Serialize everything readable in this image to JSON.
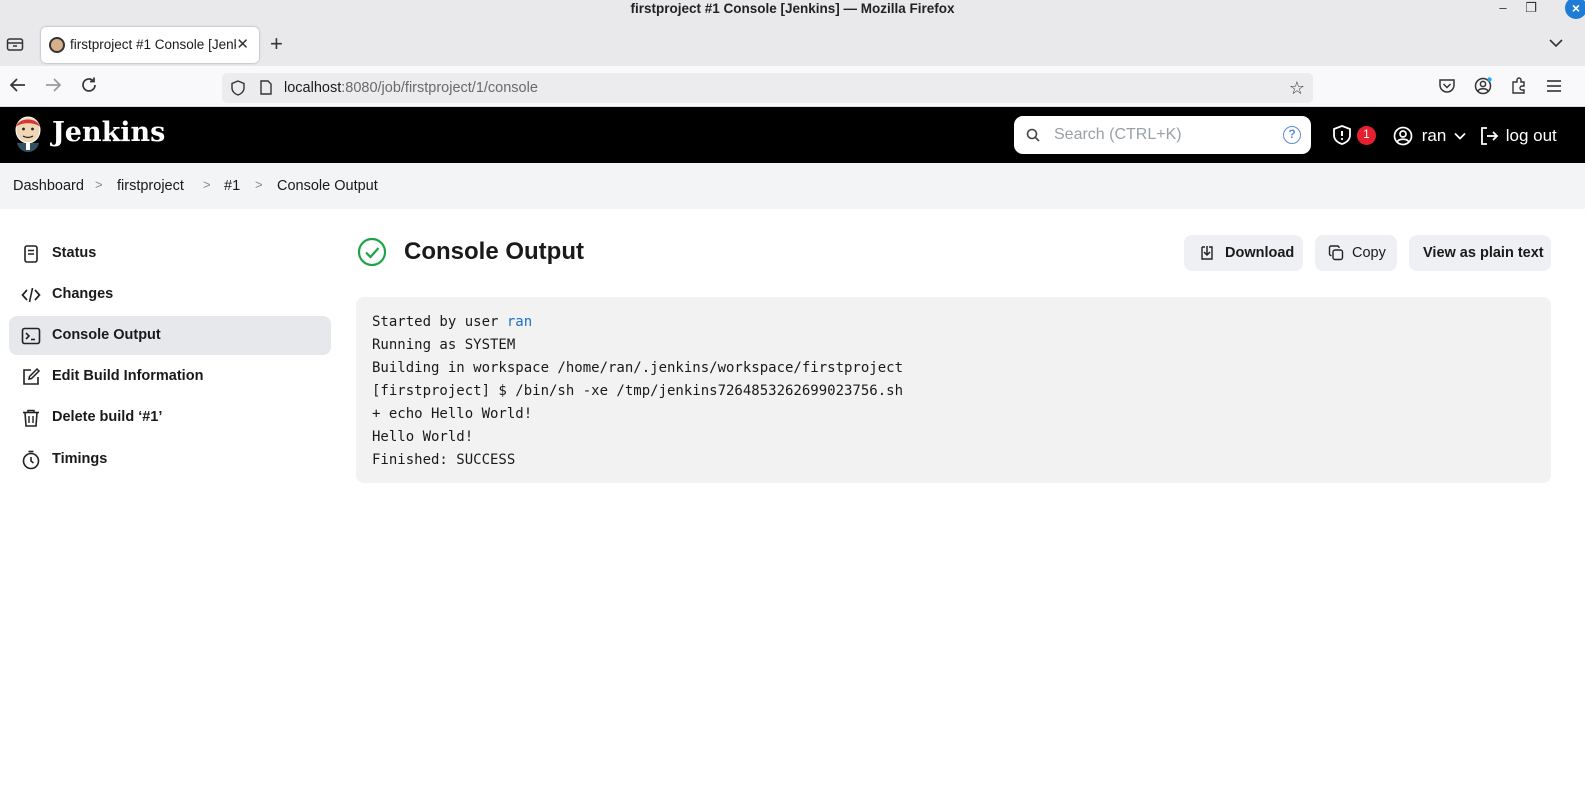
{
  "browser": {
    "window_title": "firstproject #1 Console [Jenkins] — Mozilla Firefox",
    "tab_title": "firstproject #1 Console [Jenkins]",
    "url_host": "localhost",
    "url_rest": ":8080/job/firstproject/1/console"
  },
  "header": {
    "brand": "Jenkins",
    "search_placeholder": "Search (CTRL+K)",
    "help_glyph": "?",
    "security_count": "1",
    "user": "ran",
    "logout": "log out"
  },
  "breadcrumb": [
    "Dashboard",
    "firstproject",
    "#1",
    "Console Output"
  ],
  "sidebar": {
    "items": [
      {
        "label": "Status",
        "icon": "document-icon"
      },
      {
        "label": "Changes",
        "icon": "code-icon"
      },
      {
        "label": "Console Output",
        "icon": "terminal-icon",
        "active": true
      },
      {
        "label": "Edit Build Information",
        "icon": "edit-icon"
      },
      {
        "label": "Delete build ‘#1’",
        "icon": "trash-icon"
      },
      {
        "label": "Timings",
        "icon": "stopwatch-icon"
      }
    ]
  },
  "main": {
    "title": "Console Output",
    "status": "success",
    "buttons": {
      "download": "Download",
      "copy": "Copy",
      "plain": "View as plain text"
    },
    "console": {
      "line1_prefix": "Started by user ",
      "line1_user": "ran",
      "lines": [
        "Running as SYSTEM",
        "Building in workspace /home/ran/.jenkins/workspace/firstproject",
        "[firstproject] $ /bin/sh -xe /tmp/jenkins7264853262699023756.sh",
        "+ echo Hello World!",
        "Hello World!",
        "Finished: SUCCESS"
      ]
    }
  },
  "colors": {
    "success": "#1ea446",
    "link": "#1f6fc9",
    "badge": "#e6202e"
  }
}
